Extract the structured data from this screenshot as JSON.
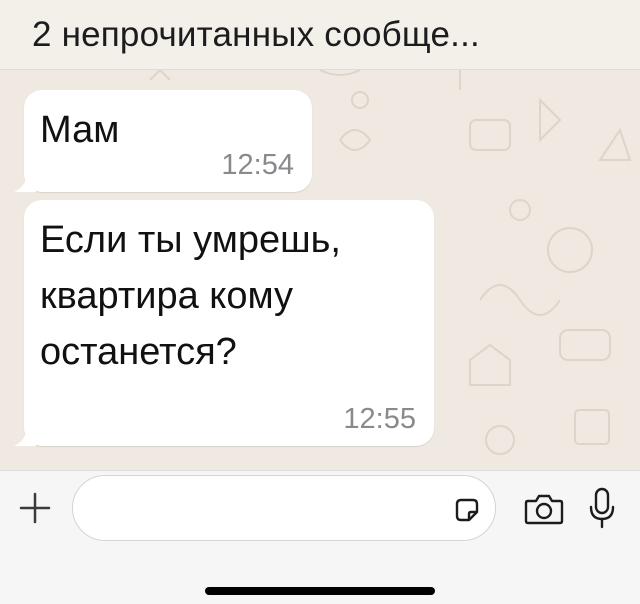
{
  "banner": {
    "unread_text": "2 непрочитанных сообще..."
  },
  "messages": [
    {
      "lines": [
        "Мам"
      ],
      "time": "12:54"
    },
    {
      "lines": [
        "Если ты умрешь,",
        "квартира кому",
        "останется?"
      ],
      "time": "12:55"
    }
  ],
  "input": {
    "placeholder": "",
    "value": ""
  },
  "icons": {
    "plus": "plus-icon",
    "sticker": "sticker-icon",
    "camera": "camera-icon",
    "mic": "microphone-icon"
  },
  "colors": {
    "chat_background": "#efe9e1",
    "bubble": "#ffffff",
    "timestamp": "#8a8a8e",
    "input_bar": "#f6f6f6"
  }
}
